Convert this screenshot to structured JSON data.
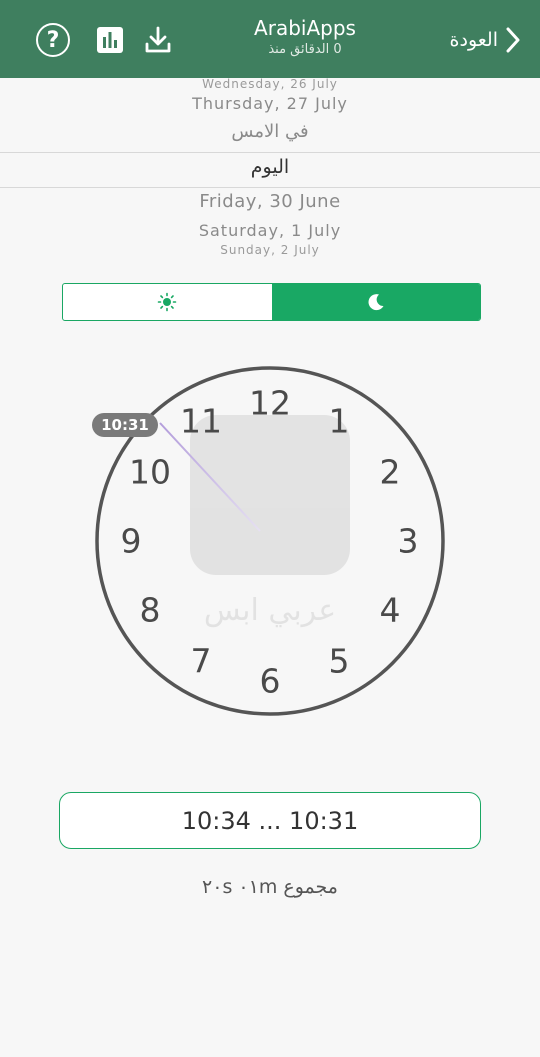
{
  "header": {
    "title": "ArabiApps",
    "subtitle": "0 الدقائق منذ",
    "back_label": "العودة",
    "icons": [
      "help-icon",
      "bar-chart-icon",
      "download-icon",
      "chevron-right-icon"
    ],
    "bg_color": "#3f7f5f"
  },
  "date_picker": {
    "rows": [
      "Wednesday, 26 July",
      "Thursday, 27 July",
      "في الامس",
      "اليوم",
      "Friday, 30 June",
      "Saturday, 1 July",
      "Sunday, 2 July"
    ],
    "selected": "اليوم"
  },
  "mode_toggle": {
    "options": [
      "sun-icon",
      "moon-icon"
    ],
    "selected": "moon-icon",
    "accent_color": "#19a864"
  },
  "clock": {
    "numbers": [
      "12",
      "1",
      "2",
      "3",
      "4",
      "5",
      "6",
      "7",
      "8",
      "9",
      "10",
      "11"
    ],
    "marker_label": "10:31",
    "hand_time": "10:31"
  },
  "range": {
    "text": "10:34 ... 10:31"
  },
  "total": {
    "text": "مجموع ٠١m ٢٠s"
  }
}
